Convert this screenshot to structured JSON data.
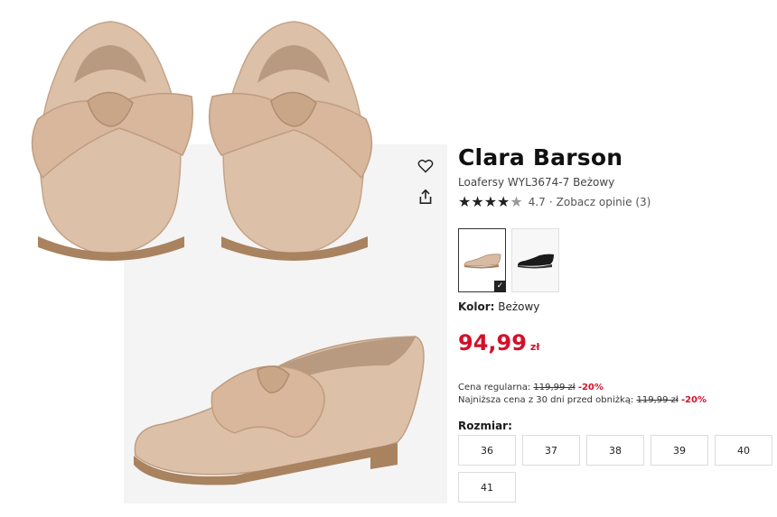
{
  "product": {
    "brand": "Clara Barson",
    "model": "Loafersy WYL3674-7 Beżowy",
    "rating": "4.7",
    "rating_stars": 4.5,
    "reviews_link": "Zobacz opinie (3)",
    "color_label": "Kolor:",
    "color_value": "Beżowy",
    "price": "94,99",
    "currency": "zł",
    "regular_price_label": "Cena regularna:",
    "regular_price": "119,99 zł",
    "regular_discount": "-20%",
    "lowest_price_label": "Najniższa cena z 30 dni przed obniżką:",
    "lowest_price": "119,99 zł",
    "lowest_discount": "-20%",
    "size_label": "Rozmiar:",
    "sizes": [
      "36",
      "37",
      "38",
      "39",
      "40",
      "41"
    ]
  },
  "icons": {
    "favorite": "heart-icon",
    "share": "share-icon",
    "selected": "check-icon"
  },
  "colors": {
    "accent_red": "#d4102a",
    "shoe_beige": "#d9bba3",
    "shoe_sole": "#a9825f"
  }
}
